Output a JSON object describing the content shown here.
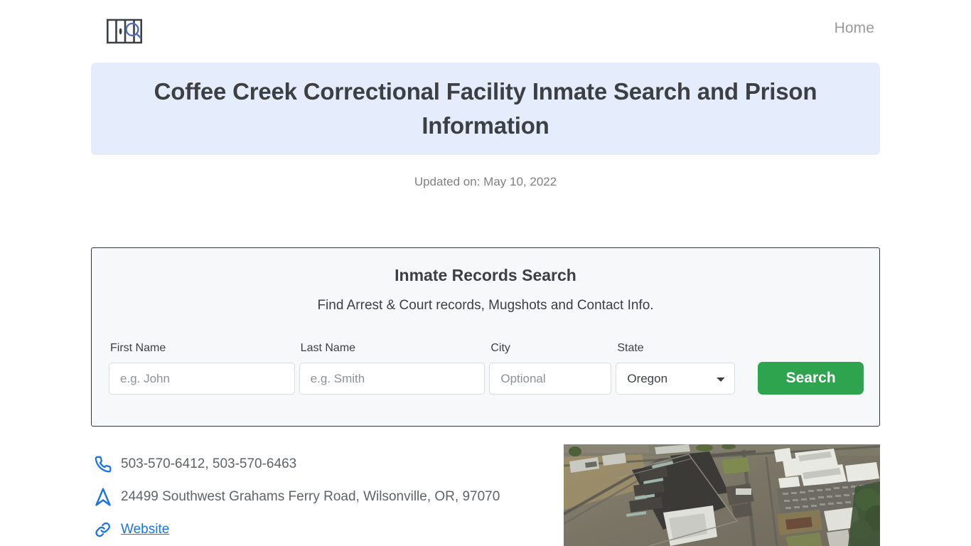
{
  "nav": {
    "logo_name": "prison-bars-search-logo",
    "links": [
      {
        "label": "Home"
      }
    ]
  },
  "banner": {
    "title": "Coffee Creek Correctional Facility Inmate Search and Prison Information",
    "background_color": "#e5ecfb",
    "text_color": "#3c4043"
  },
  "updated": {
    "text": "Updated on: May 10, 2022"
  },
  "search_card": {
    "title": "Inmate Records Search",
    "subtitle": "Find Arrest & Court records, Mugshots and Contact Info.",
    "fields": {
      "first_name": {
        "label": "First Name",
        "placeholder": "e.g. John",
        "value": ""
      },
      "last_name": {
        "label": "Last Name",
        "placeholder": "e.g. Smith",
        "value": ""
      },
      "city": {
        "label": "City",
        "placeholder": "Optional",
        "value": ""
      },
      "state": {
        "label": "State",
        "selected": "Oregon",
        "options": [
          "Oregon"
        ]
      }
    },
    "search_button": {
      "label": "Search",
      "color": "#2ea44f"
    }
  },
  "contact": {
    "phone": {
      "icon": "phone-icon",
      "text": "503-570-6412, 503-570-6463"
    },
    "address": {
      "icon": "navigation-arrow-icon",
      "text": "24499 Southwest Grahams Ferry Road, Wilsonville, OR, 97070"
    },
    "website": {
      "icon": "link-icon",
      "text": "Website",
      "color": "#1a73e8"
    }
  },
  "aerial_photo": {
    "alt": "Aerial photograph of Coffee Creek Correctional Facility"
  }
}
